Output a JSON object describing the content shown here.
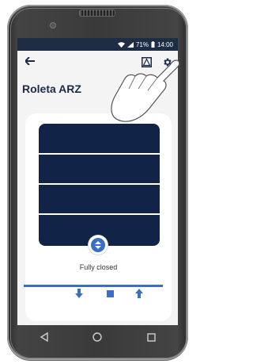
{
  "status_bar": {
    "battery": "71%",
    "time": "14:00"
  },
  "header": {
    "title": "Roleta ARZ"
  },
  "blind": {
    "position_percent_closed": 100,
    "status_text": "Fully closed"
  },
  "icons": {
    "back": "arrow-left-icon",
    "scene": "window-icon",
    "settings": "gear-icon",
    "updown": "up-down-chevron-icon",
    "down": "arrow-down-icon",
    "stop": "stop-square-icon",
    "up": "arrow-up-icon"
  },
  "colors": {
    "primary": "#1b2b4a",
    "accent": "#3a6fc4",
    "blind": "#112448",
    "statusbar": "#1e2c44"
  }
}
